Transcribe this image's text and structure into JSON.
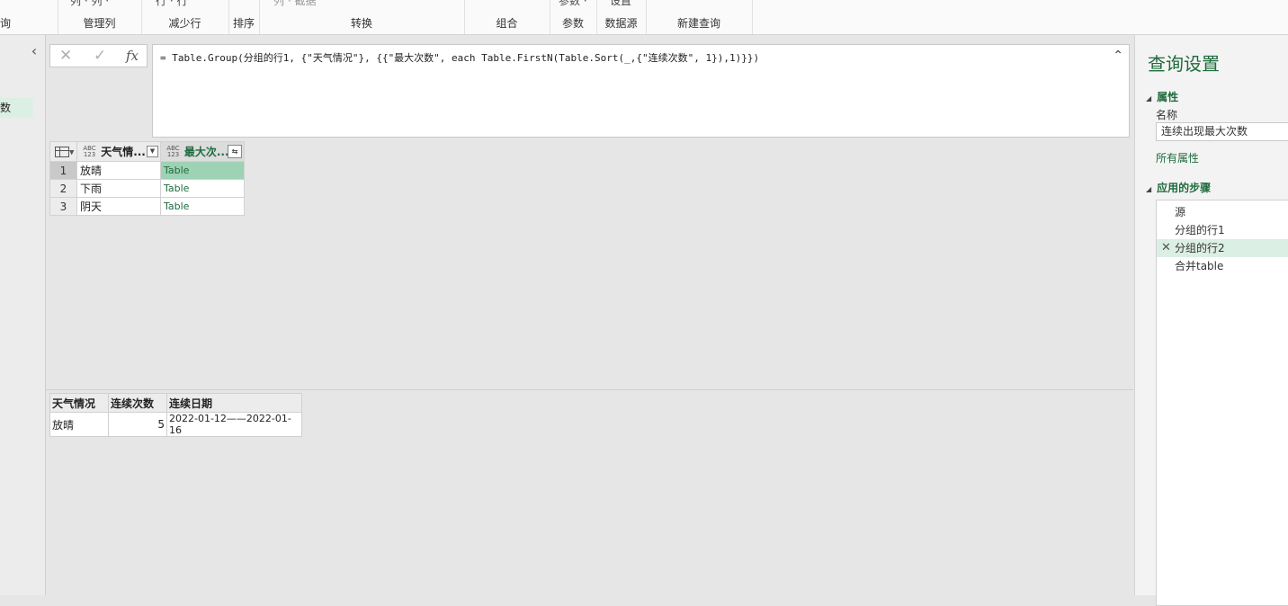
{
  "ribbon": {
    "groups": [
      {
        "label": "询",
        "cut": ""
      },
      {
        "label": "管理列",
        "cut": "列 ·     列 ·"
      },
      {
        "label": "减少行",
        "cut": "行 ·     行"
      },
      {
        "label": "排序",
        "cut": ""
      },
      {
        "label": "转换",
        "cut": "列 ·     截据"
      },
      {
        "label": "组合",
        "cut": ""
      },
      {
        "label": "参数",
        "cut": "参数 ·"
      },
      {
        "label": "数据源",
        "cut": "设置"
      },
      {
        "label": "新建查询",
        "cut": ""
      }
    ]
  },
  "queries": {
    "collapse_glyph": "‹",
    "items": [
      {
        "label": "数"
      }
    ]
  },
  "formula_bar": {
    "cancel_glyph": "✕",
    "confirm_glyph": "✓",
    "fx_label": "fx",
    "text": "= Table.Group(分组的行1, {\"天气情况\"}, {{\"最大次数\", each Table.FirstN(Table.Sort(_,{\"连续次数\", 1}),1)}})",
    "expand_glyph": "⌃"
  },
  "grid": {
    "columns": [
      {
        "type_badge": "ABC 123",
        "name": "天气情..."
      },
      {
        "type_badge": "ABC 123",
        "name": "最大次..."
      }
    ],
    "rows": [
      {
        "num": "1",
        "c1": "放晴",
        "c2": "Table"
      },
      {
        "num": "2",
        "c1": "下雨",
        "c2": "Table"
      },
      {
        "num": "3",
        "c1": "阴天",
        "c2": "Table"
      }
    ]
  },
  "preview": {
    "headers": [
      "天气情况",
      "连续次数",
      "连续日期"
    ],
    "rows": [
      {
        "c1": "放晴",
        "c2": "5",
        "c3": "2022-01-12——2022-01-16"
      }
    ]
  },
  "settings": {
    "title": "查询设置",
    "properties_header": "属性",
    "name_label": "名称",
    "name_value": "连续出现最大次数",
    "all_properties": "所有属性",
    "steps_header": "应用的步骤",
    "delete_glyph": "✕",
    "steps": [
      "源",
      "分组的行1",
      "分组的行2",
      "合并table"
    ]
  }
}
